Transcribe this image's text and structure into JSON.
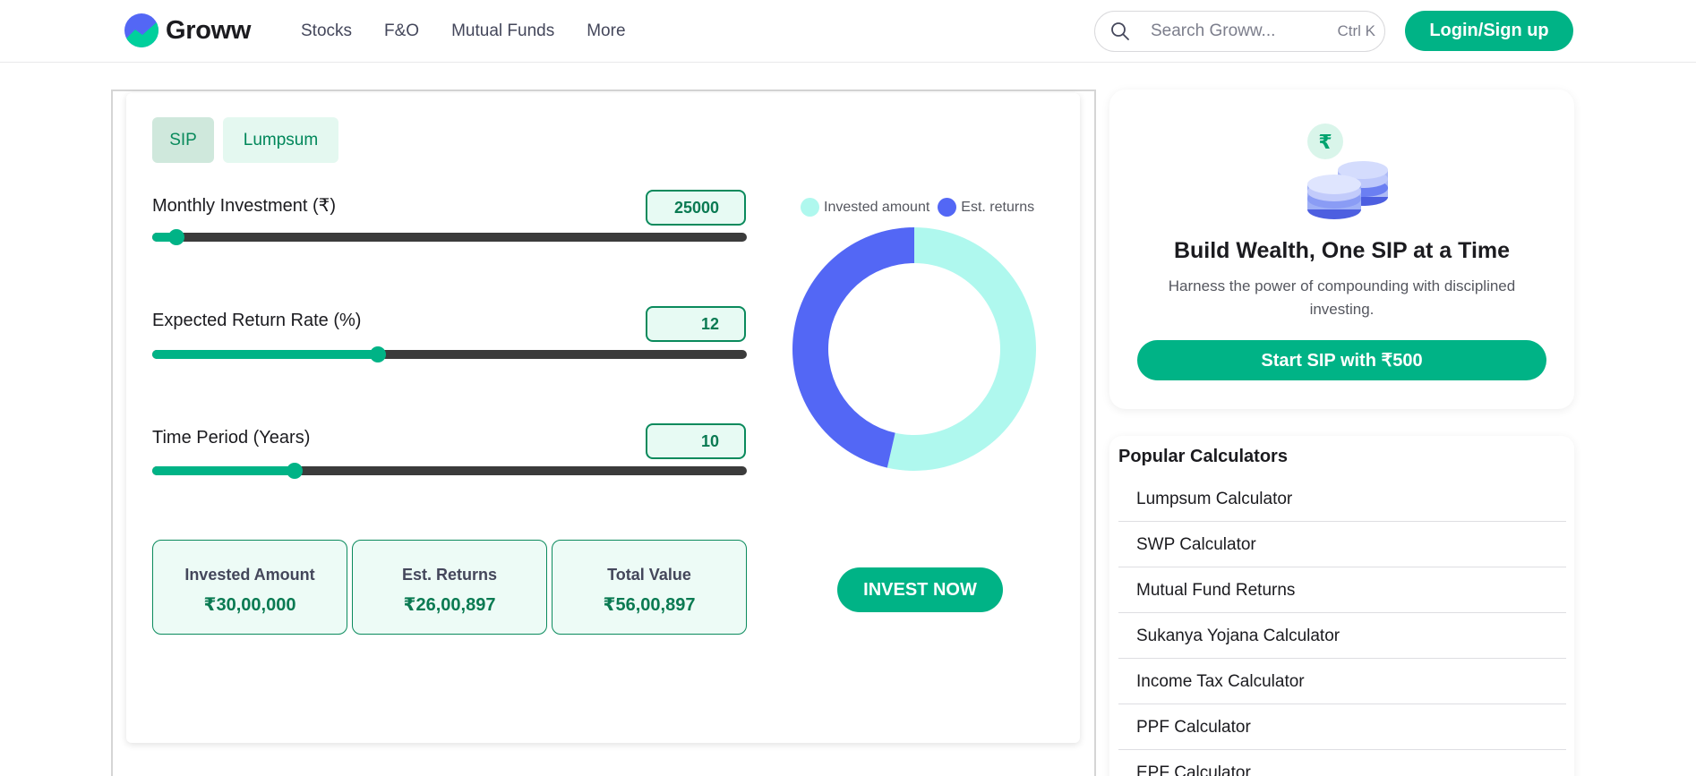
{
  "header": {
    "brand": "Groww",
    "nav": [
      "Stocks",
      "F&O",
      "Mutual Funds",
      "More"
    ],
    "search_placeholder": "Search Groww...",
    "search_shortcut": "Ctrl K",
    "login_label": "Login/Sign up"
  },
  "calculator": {
    "tabs": [
      "SIP",
      "Lumpsum"
    ],
    "active_tab": "SIP",
    "inputs": [
      {
        "label": "Monthly Investment (₹)",
        "value": "25000",
        "slider_fraction": 0.04
      },
      {
        "label": "Expected Return Rate (%)",
        "value": "12",
        "slider_fraction": 0.38
      },
      {
        "label": "Time Period (Years)",
        "value": "10",
        "slider_fraction": 0.24
      }
    ],
    "results": [
      {
        "title": "Invested Amount",
        "value": "₹30,00,000"
      },
      {
        "title": "Est. Returns",
        "value": "₹26,00,897"
      },
      {
        "title": "Total Value",
        "value": "₹56,00,897"
      }
    ],
    "invest_button": "INVEST NOW"
  },
  "chart_data": {
    "type": "pie",
    "variant": "donut",
    "series": [
      {
        "name": "Invested amount",
        "value": 3000000,
        "color": "#aff8ee"
      },
      {
        "name": "Est. returns",
        "value": 2600897,
        "color": "#5367f5"
      }
    ],
    "legend_position": "top"
  },
  "promo": {
    "title": "Build Wealth, One SIP at a Time",
    "subtitle": "Harness the power of compounding with disciplined investing.",
    "button": "Start SIP with ₹500"
  },
  "popular": {
    "title": "Popular Calculators",
    "items": [
      "Lumpsum Calculator",
      "SWP Calculator",
      "Mutual Fund Returns",
      "Sukanya Yojana Calculator",
      "Income Tax Calculator",
      "PPF Calculator",
      "EPF Calculator"
    ]
  },
  "colors": {
    "accent": "#00b386",
    "accent_dark": "#0a8a5c",
    "invested": "#aff8ee",
    "returns": "#5367f5"
  }
}
